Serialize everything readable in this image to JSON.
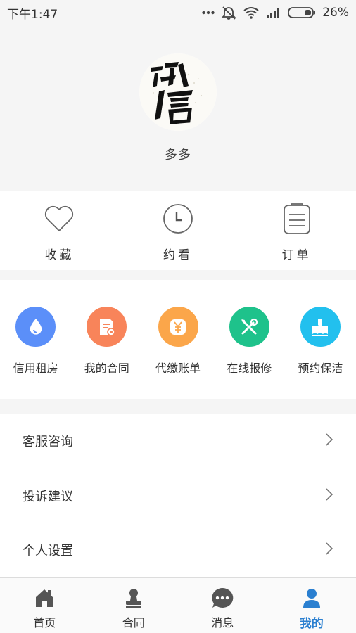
{
  "status_bar": {
    "time": "下午1:47",
    "battery": "26%",
    "icons": [
      "more-dots-icon",
      "mute-icon",
      "wifi-icon",
      "signal-icon",
      "battery-icon"
    ]
  },
  "profile": {
    "username": "多多",
    "avatar": "calligraphy-avatar"
  },
  "quick_actions": [
    {
      "label": "收藏",
      "icon": "heart-icon"
    },
    {
      "label": "约看",
      "icon": "clock-icon"
    },
    {
      "label": "订单",
      "icon": "order-list-icon"
    }
  ],
  "services": [
    {
      "label": "信用租房",
      "icon": "credit-drop-icon",
      "color": "#5b8ff9"
    },
    {
      "label": "我的合同",
      "icon": "contract-doc-icon",
      "color": "#f8845a"
    },
    {
      "label": "代缴账单",
      "icon": "bill-yuan-icon",
      "color": "#fba64a"
    },
    {
      "label": "在线报修",
      "icon": "tools-icon",
      "color": "#1ec28b"
    },
    {
      "label": "预约保洁",
      "icon": "broom-icon",
      "color": "#22c0ee"
    }
  ],
  "menu": [
    {
      "label": "客服咨询"
    },
    {
      "label": "投诉建议"
    },
    {
      "label": "个人设置"
    }
  ],
  "tabs": [
    {
      "label": "首页",
      "icon": "home-icon"
    },
    {
      "label": "合同",
      "icon": "stamp-icon"
    },
    {
      "label": "消息",
      "icon": "message-icon"
    },
    {
      "label": "我的",
      "icon": "user-icon",
      "active": true
    }
  ],
  "colors": {
    "accent": "#2a7fd0",
    "tab_icon": "#555555",
    "background": "#f5f5f5"
  }
}
